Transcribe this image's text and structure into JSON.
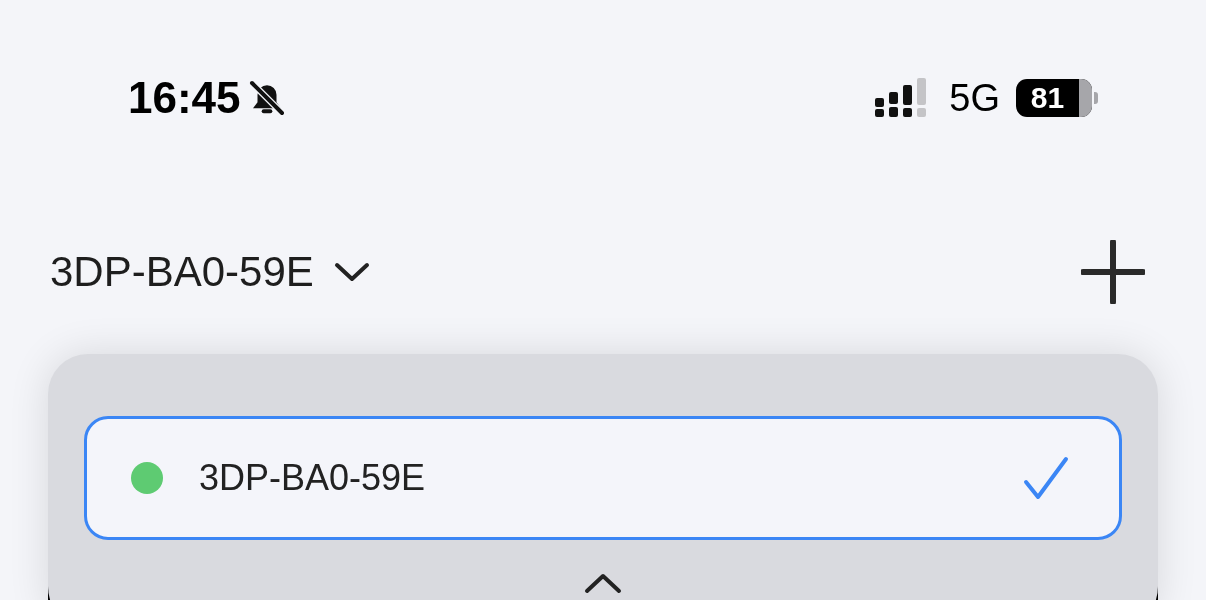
{
  "status_bar": {
    "time": "16:45",
    "silent": true,
    "network": "5G",
    "battery": "81"
  },
  "header": {
    "title": "3DP-BA0-59E"
  },
  "printer_menu": {
    "items": [
      {
        "name": "3DP-BA0-59E",
        "color": "#5ecb72",
        "selected": true
      }
    ]
  }
}
